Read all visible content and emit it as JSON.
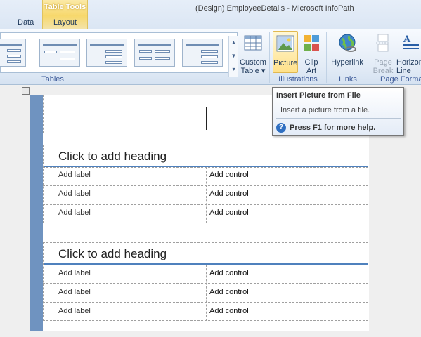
{
  "window": {
    "title": "(Design) EmployeeDetails  -  Microsoft InfoPath",
    "contextual_tab_group": "Table Tools",
    "tabs": [
      {
        "label": "Data"
      },
      {
        "label": "Layout"
      }
    ]
  },
  "ribbon": {
    "groups": {
      "tables": "Tables",
      "illustrations": "Illustrations",
      "links": "Links",
      "page_format": "Page Format"
    },
    "buttons": {
      "custom_table_line1": "Custom",
      "custom_table_line2": "Table ▾",
      "picture": "Picture",
      "clip_art_line1": "Clip",
      "clip_art_line2": "Art",
      "hyperlink": "Hyperlink",
      "page_break_line1": "Page",
      "page_break_line2": "Break",
      "horizontal_line_line1": "Horizon",
      "horizontal_line_line2": "Line"
    },
    "icons": {
      "custom_table": "table-grid-icon",
      "picture": "picture-icon",
      "clip_art": "clip-art-icon",
      "hyperlink": "globe-link-icon",
      "page_break": "page-break-icon",
      "horizontal_line": "horizontal-line-icon"
    }
  },
  "tooltip": {
    "title": "Insert Picture from File",
    "description": "Insert a picture from a file.",
    "help": "Press F1 for more help."
  },
  "form": {
    "sections": [
      {
        "heading": "Click to add heading",
        "rows": [
          {
            "label": "Add label",
            "control": "Add control"
          },
          {
            "label": "Add label",
            "control": "Add control"
          },
          {
            "label": "Add label",
            "control": "Add control"
          }
        ]
      },
      {
        "heading": "Click to add heading",
        "rows": [
          {
            "label": "Add label",
            "control": "Add control"
          },
          {
            "label": "Add label",
            "control": "Add control"
          },
          {
            "label": "Add label",
            "control": "Add control"
          }
        ]
      }
    ]
  },
  "colors": {
    "accent_stripe": "#6f93c0",
    "heading_rule": "#4f81bd",
    "contextual_tab": "#f7d86c"
  }
}
